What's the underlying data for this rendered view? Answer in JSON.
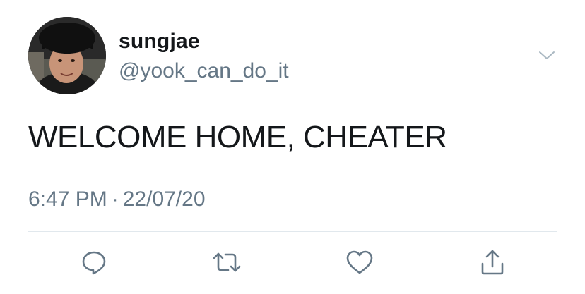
{
  "tweet": {
    "display_name": "sungjae",
    "handle": "@yook_can_do_it",
    "text": "WELCOME HOME, CHEATER",
    "time": "6:47 PM",
    "separator": "·",
    "date": "22/07/20"
  },
  "icons": {
    "menu": "chevron-down-icon",
    "reply": "reply-icon",
    "retweet": "retweet-icon",
    "like": "heart-icon",
    "share": "share-icon"
  },
  "colors": {
    "text": "#14171a",
    "secondary": "#657786",
    "icon": "#657786",
    "divider": "#e1e8ed"
  }
}
